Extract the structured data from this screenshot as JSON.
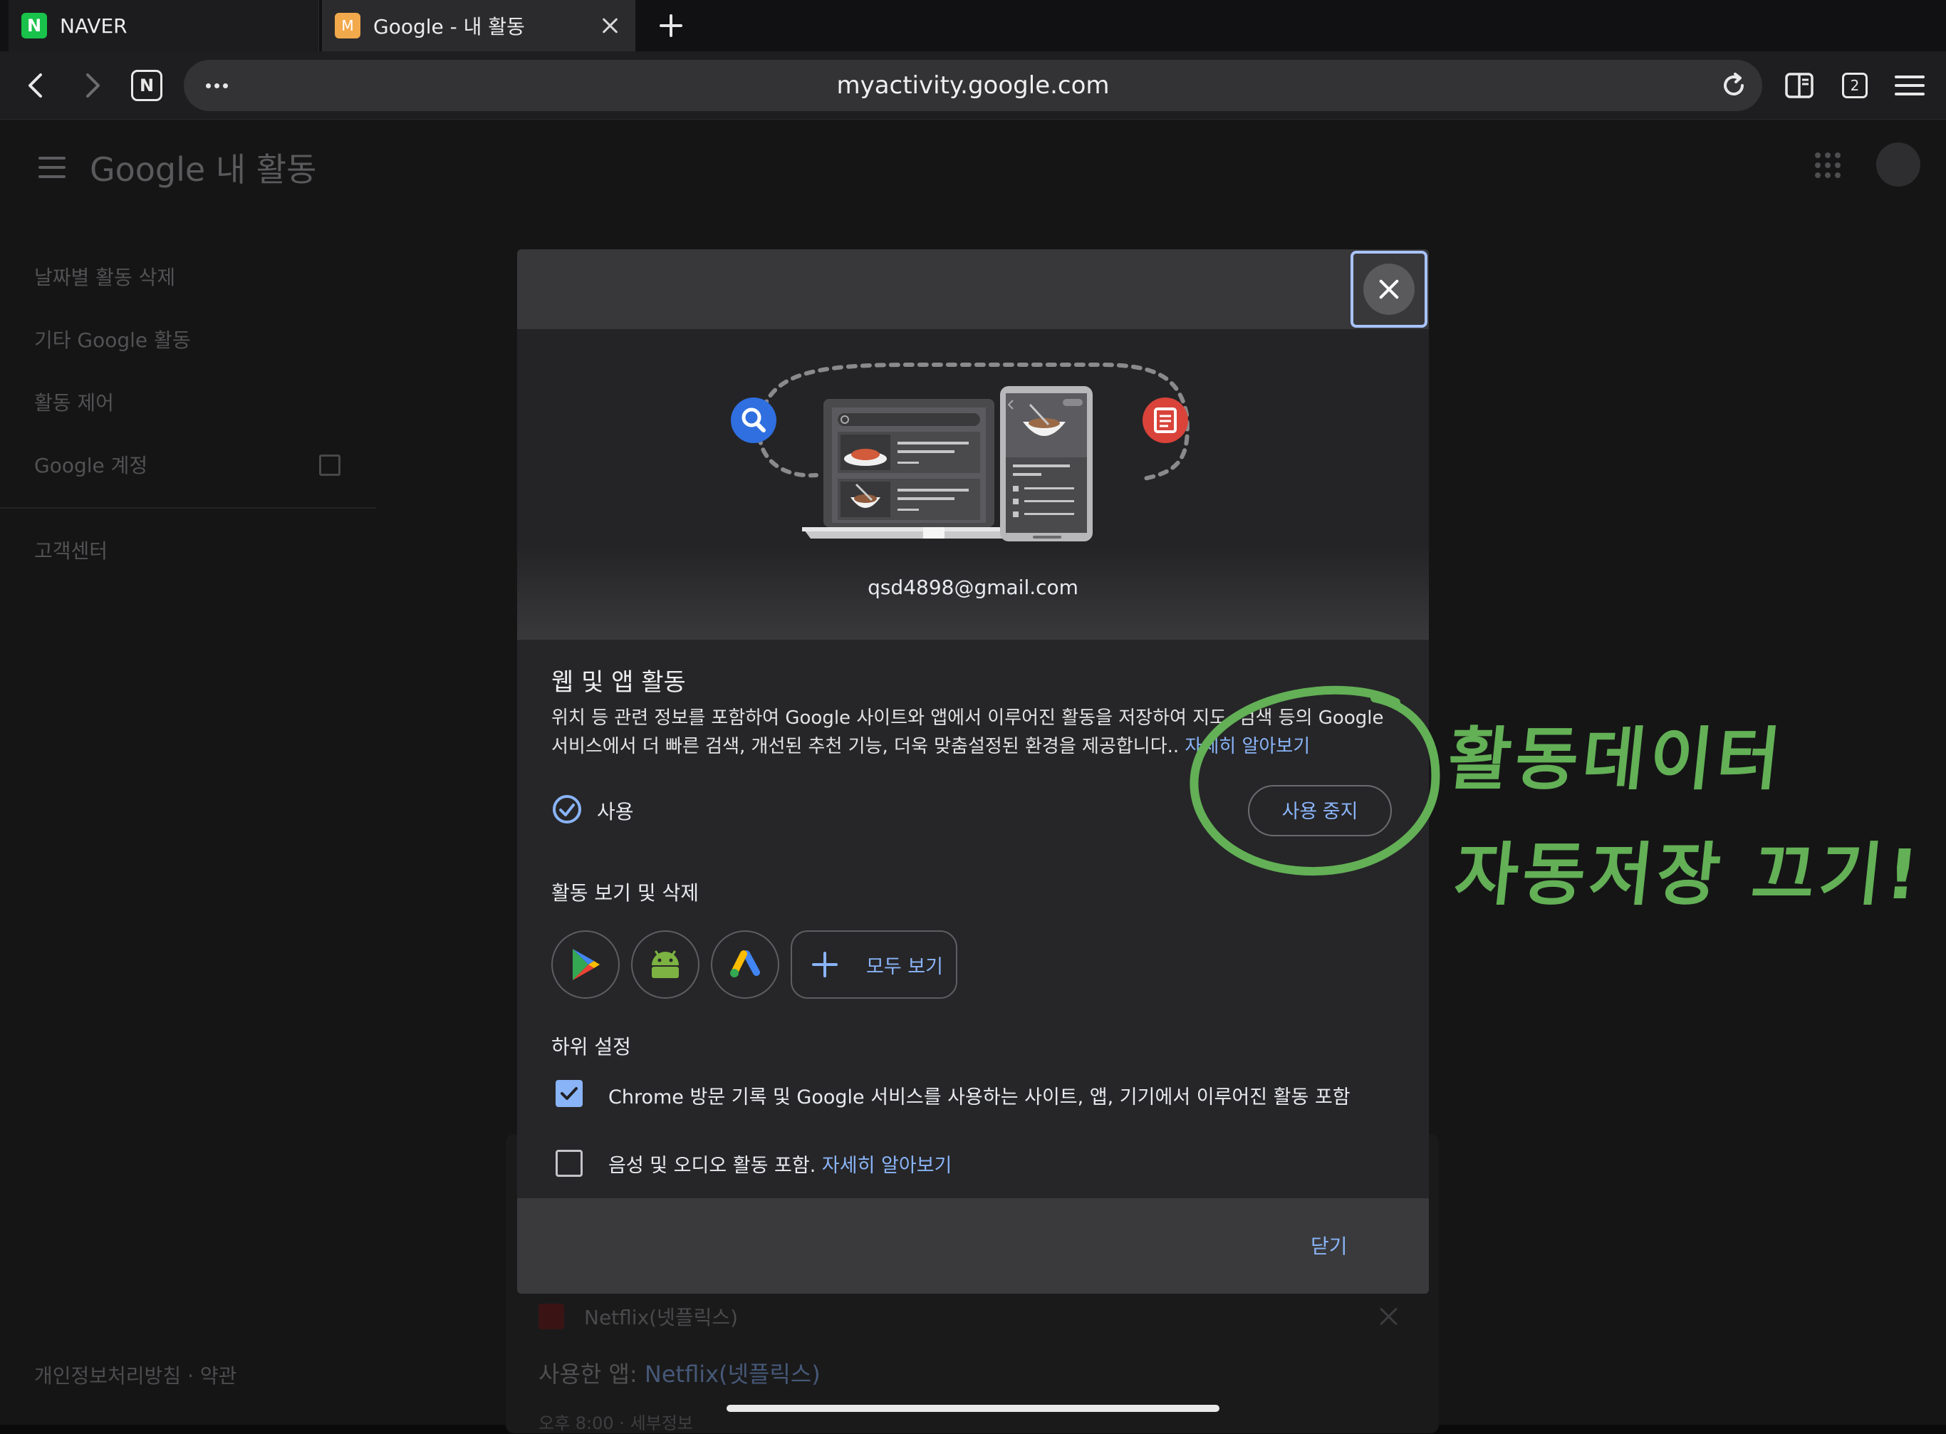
{
  "tabs": [
    {
      "favicon": "N",
      "title": "NAVER"
    },
    {
      "favicon": "M",
      "title": "Google - 내 활동"
    }
  ],
  "toolbar": {
    "url": "myactivity.google.com",
    "tab_count": "2"
  },
  "background": {
    "logo_text": "Google 내 활동",
    "nav": [
      "날짜별 활동 삭제",
      "기타 Google 활동",
      "활동 제어",
      "Google 계정",
      "고객센터"
    ],
    "footer": "개인정보처리방침 · 약관",
    "card": {
      "app_name": "Netflix(넷플릭스)",
      "used_app_prefix": "사용한 앱: ",
      "used_app_name": "Netflix(넷플릭스)",
      "time": "오후 8:00 · 세부정보"
    }
  },
  "dialog": {
    "email": "qsd4898@gmail.com",
    "title": "웹 및 앱 활동",
    "description": "위치 등 관련 정보를 포함하여 Google 사이트와 앱에서 이루어진 활동을 저장하여 지도, 검색 등의 Google 서비스에서 더 빠른 검색, 개선된 추천 기능, 더욱 맞춤설정된 환경을 제공합니다..",
    "learn_more": "자세히 알아보기",
    "status_label": "사용",
    "pause_button": "사용 중지",
    "view_delete_title": "활동 보기 및 삭제",
    "apps": [
      "google-play-icon",
      "android-icon",
      "google-ads-icon"
    ],
    "see_all": "모두 보기",
    "subsettings_title": "하위 설정",
    "checkbox_chrome": {
      "label": "Chrome 방문 기록 및 Google 서비스를 사용하는 사이트, 앱, 기기에서 이루어진 활동 포함",
      "checked": true
    },
    "checkbox_audio": {
      "label": "음성 및 오디오 활동 포함.",
      "link": "자세히 알아보기",
      "checked": false
    },
    "close_button": "닫기"
  },
  "annotation": {
    "line1": "활동데이터",
    "line2": "자동저장 끄기!",
    "color": "#63b056"
  },
  "colors": {
    "accent": "#8ab4f8",
    "focus_ring": "#a9c3ff"
  }
}
